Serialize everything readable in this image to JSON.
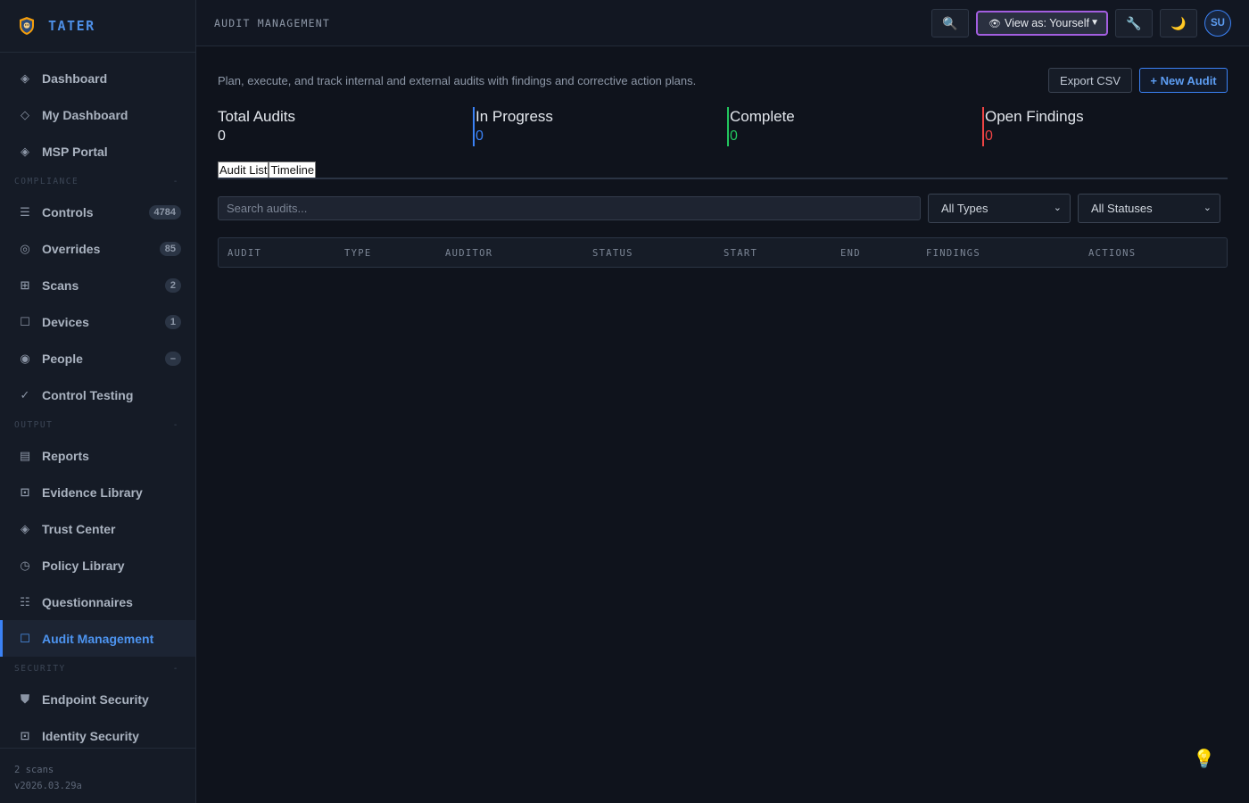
{
  "brand": {
    "name": "TATER"
  },
  "nav": [
    {
      "type": "item",
      "key": "dashboard",
      "label": "Dashboard",
      "icon": "◈",
      "icon_name": "diamond-icon"
    },
    {
      "type": "item",
      "key": "my-dashboard",
      "label": "My Dashboard",
      "icon": "◇",
      "icon_name": "diamond-outline-icon"
    },
    {
      "type": "item",
      "key": "msp-portal",
      "label": "MSP Portal",
      "icon": "◈",
      "icon_name": "diamond-icon"
    },
    {
      "type": "section",
      "key": "compliance",
      "label": "COMPLIANCE",
      "toggle": "-"
    },
    {
      "type": "item",
      "key": "controls",
      "label": "Controls",
      "icon": "☰",
      "icon_name": "list-icon",
      "badge": "4784"
    },
    {
      "type": "item",
      "key": "overrides",
      "label": "Overrides",
      "icon": "◎",
      "icon_name": "target-icon",
      "badge": "85"
    },
    {
      "type": "item",
      "key": "scans",
      "label": "Scans",
      "icon": "⊞",
      "icon_name": "grid-icon",
      "badge": "2"
    },
    {
      "type": "item",
      "key": "devices",
      "label": "Devices",
      "icon": "☐",
      "icon_name": "square-icon",
      "badge": "1"
    },
    {
      "type": "item",
      "key": "people",
      "label": "People",
      "icon": "◉",
      "icon_name": "circle-dot-icon",
      "badge": "–"
    },
    {
      "type": "item",
      "key": "control-testing",
      "label": "Control Testing",
      "icon": "✓",
      "icon_name": "check-icon"
    },
    {
      "type": "section",
      "key": "output",
      "label": "OUTPUT",
      "toggle": "-"
    },
    {
      "type": "item",
      "key": "reports",
      "label": "Reports",
      "icon": "▤",
      "icon_name": "report-icon"
    },
    {
      "type": "item",
      "key": "evidence-library",
      "label": "Evidence Library",
      "icon": "⊡",
      "icon_name": "evidence-icon"
    },
    {
      "type": "item",
      "key": "trust-center",
      "label": "Trust Center",
      "icon": "◈",
      "icon_name": "diamond-icon"
    },
    {
      "type": "item",
      "key": "policy-library",
      "label": "Policy Library",
      "icon": "◷",
      "icon_name": "clock-icon"
    },
    {
      "type": "item",
      "key": "questionnaires",
      "label": "Questionnaires",
      "icon": "☷",
      "icon_name": "checklist-icon"
    },
    {
      "type": "item",
      "key": "audit-management",
      "label": "Audit Management",
      "icon": "☐",
      "icon_name": "square-icon",
      "active": true
    },
    {
      "type": "section",
      "key": "security",
      "label": "SECURITY",
      "toggle": "-"
    },
    {
      "type": "item",
      "key": "endpoint-security",
      "label": "Endpoint Security",
      "icon": "⛊",
      "icon_name": "shield-icon"
    },
    {
      "type": "item",
      "key": "identity-security",
      "label": "Identity Security",
      "icon": "⊡",
      "icon_name": "id-card-icon"
    }
  ],
  "footer": {
    "scans": "2 scans",
    "version": "v2026.03.29a"
  },
  "topbar": {
    "crumb": "AUDIT MANAGEMENT",
    "search_icon": "🔍",
    "view_as": "View as: Yourself",
    "view_as_icon": "👁",
    "tools_icon": "🔧",
    "theme_icon": "🌙",
    "avatar": "SU"
  },
  "main": {
    "description": "Plan, execute, and track internal and external audits with findings and corrective action plans.",
    "export_label": "Export CSV",
    "new_label": "+ New Audit",
    "stats": [
      {
        "label": "Total Audits",
        "value": "0",
        "color": "#e3e7ed"
      },
      {
        "label": "In Progress",
        "value": "0",
        "color": "#3b82f6"
      },
      {
        "label": "Complete",
        "value": "0",
        "color": "#22c55e"
      },
      {
        "label": "Open Findings",
        "value": "0",
        "color": "#ef4444"
      }
    ],
    "tabs": [
      "Audit List",
      "Timeline"
    ],
    "search_placeholder": "Search audits...",
    "type_filter": "All Types",
    "status_filter": "All Statuses",
    "columns": [
      "AUDIT",
      "TYPE",
      "AUDITOR",
      "STATUS",
      "START",
      "END",
      "FINDINGS",
      "ACTIONS"
    ]
  },
  "hint_icon": "💡"
}
